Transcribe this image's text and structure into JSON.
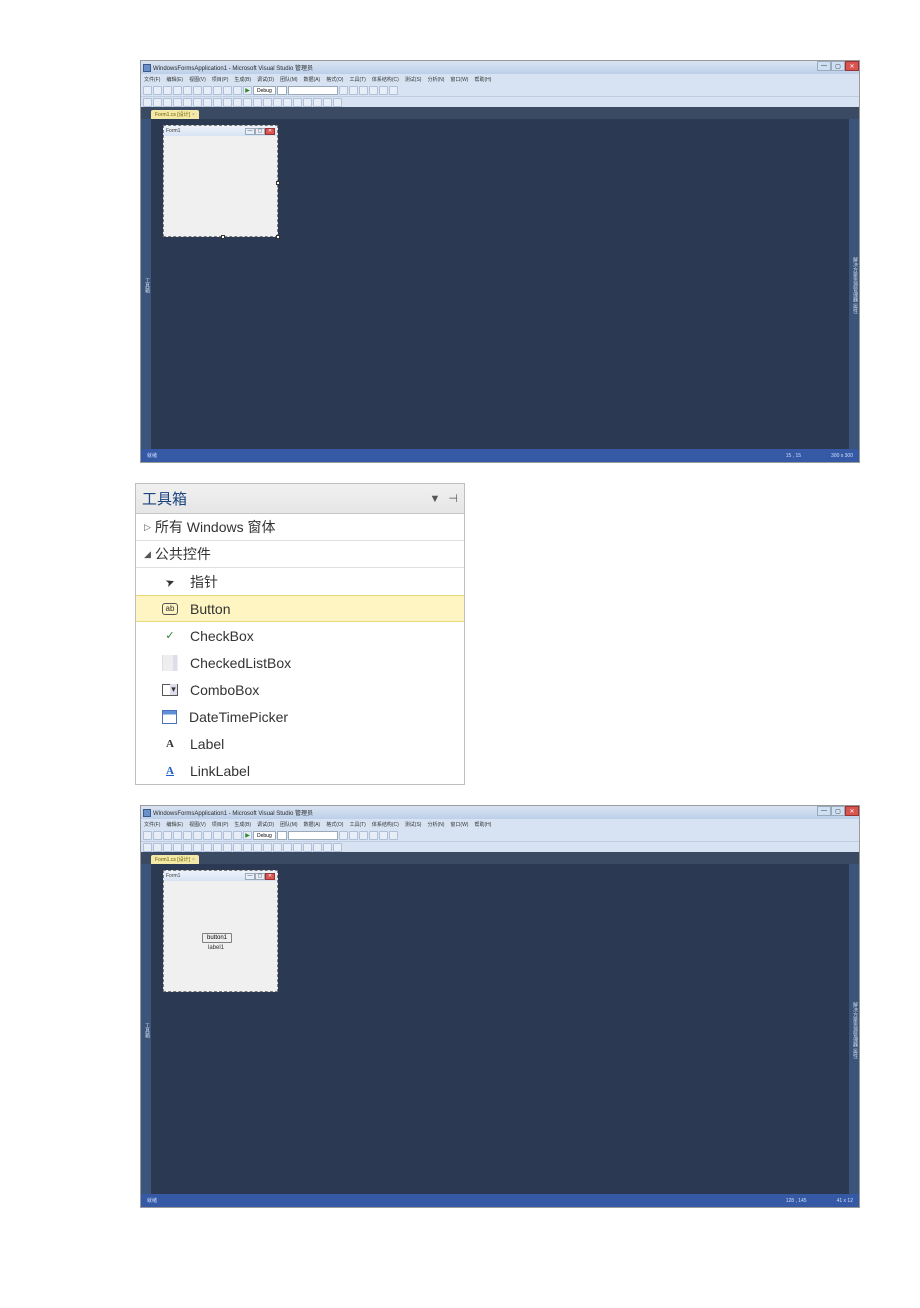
{
  "vs1": {
    "title": "WindowsFormsApplication1 - Microsoft Visual Studio 管理员",
    "menus": [
      "文件(F)",
      "编辑(E)",
      "视图(V)",
      "项目(P)",
      "生成(B)",
      "调试(D)",
      "团队(M)",
      "数据(A)",
      "格式(O)",
      "工具(T)",
      "体系结构(C)",
      "测试(S)",
      "分析(N)",
      "窗口(W)",
      "帮助(H)"
    ],
    "config": "Debug",
    "tab": "Form1.cs [设计]",
    "formTitle": "Form1",
    "status_left": "就绪",
    "coords": "15 , 15",
    "size": "300 x 300"
  },
  "toolbox": {
    "title": "工具箱",
    "groups": {
      "all_windows": "所有 Windows 窗体",
      "common": "公共控件"
    },
    "items": {
      "pointer": "指针",
      "button": "Button",
      "checkbox": "CheckBox",
      "checkedlistbox": "CheckedListBox",
      "combobox": "ComboBox",
      "datetimepicker": "DateTimePicker",
      "label": "Label",
      "linklabel": "LinkLabel"
    }
  },
  "vs2": {
    "title": "WindowsFormsApplication1 - Microsoft Visual Studio 管理员",
    "menus": [
      "文件(F)",
      "编辑(E)",
      "视图(V)",
      "项目(P)",
      "生成(B)",
      "调试(D)",
      "团队(M)",
      "数据(A)",
      "格式(O)",
      "工具(T)",
      "体系结构(C)",
      "测试(S)",
      "分析(N)",
      "窗口(W)",
      "帮助(H)"
    ],
    "config": "Debug",
    "tab": "Form1.cs [设计]",
    "formTitle": "Form1",
    "button1": "button1",
    "label1": "label1",
    "status_left": "就绪",
    "coords": "128 , 145",
    "size": "41 x 12"
  }
}
